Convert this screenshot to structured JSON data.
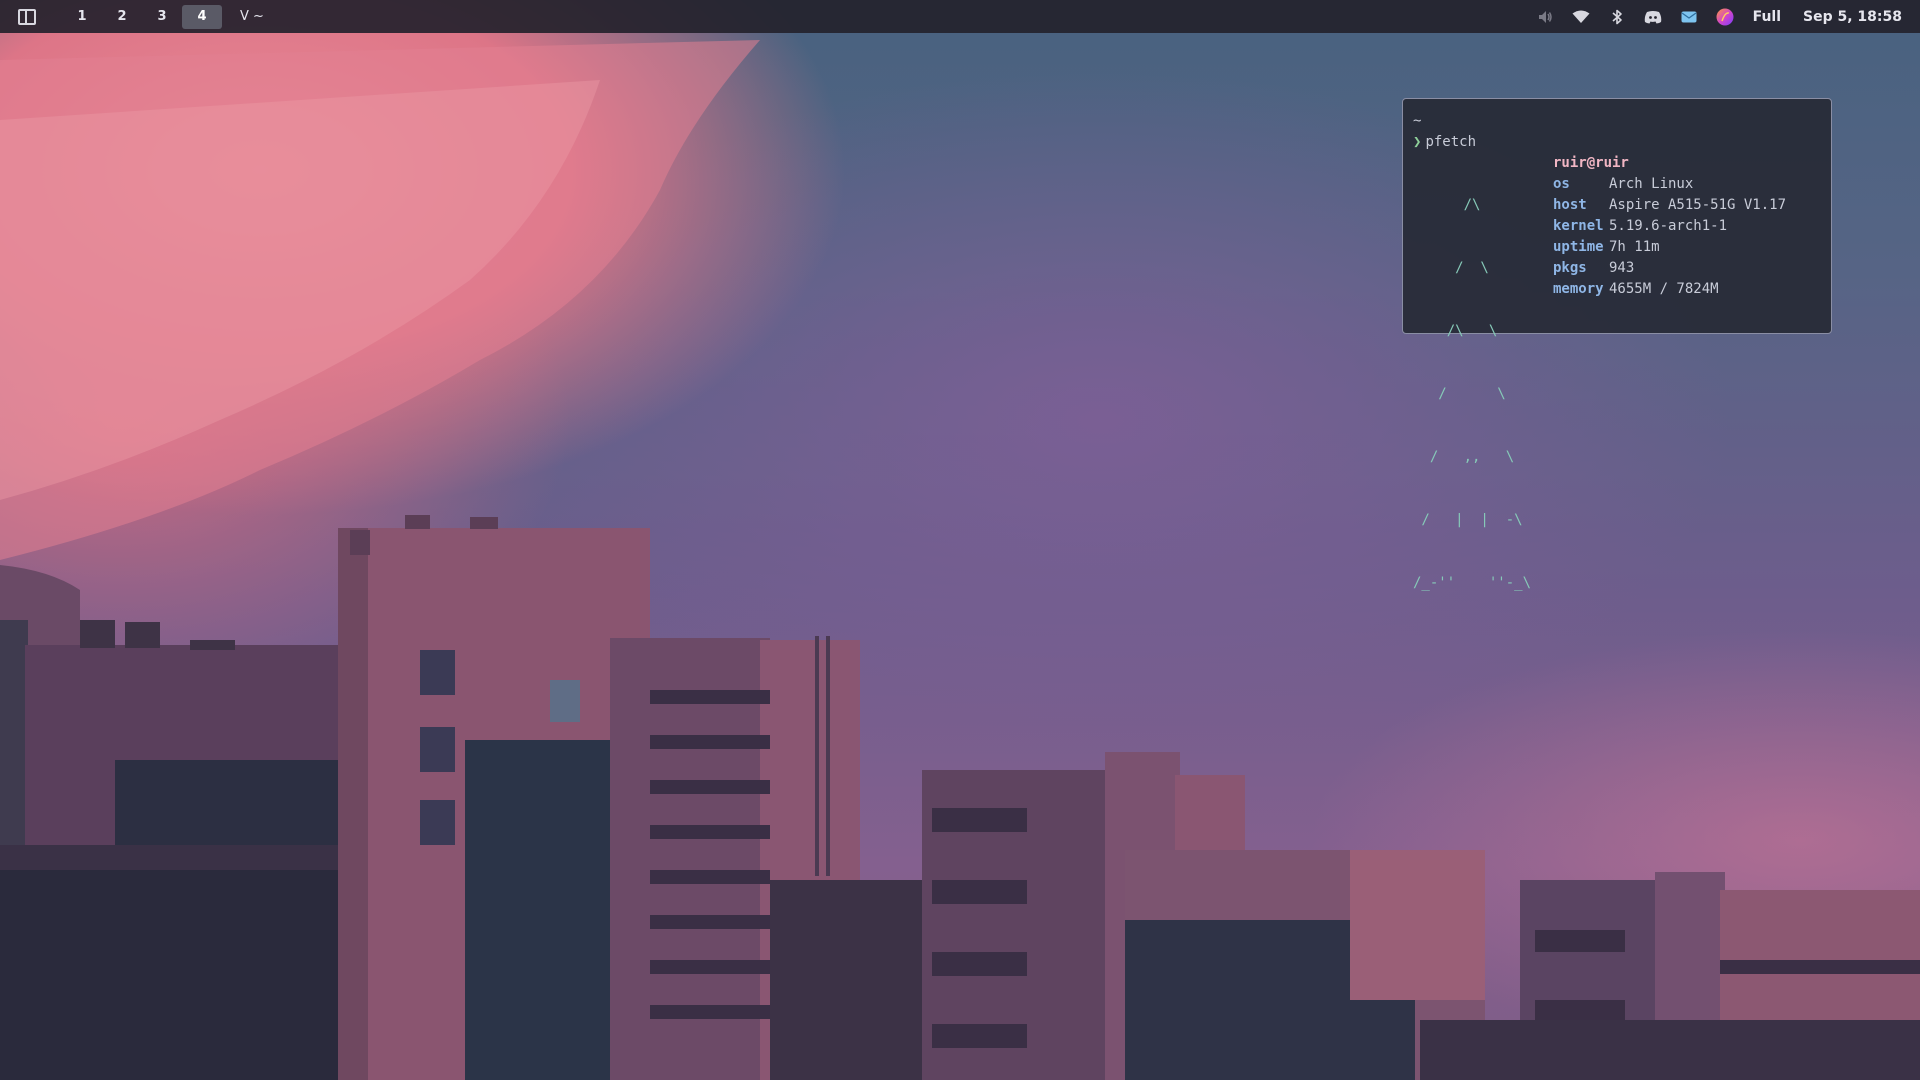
{
  "topbar": {
    "workspaces": [
      "1",
      "2",
      "3",
      "4"
    ],
    "active_workspace": "4",
    "window_title": "V ~",
    "tray": [
      "volume-icon",
      "wifi-icon",
      "bluetooth-icon",
      "discord-icon",
      "mail-icon",
      "app-orb-icon"
    ],
    "battery": "Full",
    "clock": "Sep 5, 18:58"
  },
  "terminal": {
    "cwd": "~",
    "prompt_symbol": "❯",
    "command": "pfetch",
    "userhost": "ruir@ruir",
    "ascii_art": [
      "      /\\",
      "     /  \\",
      "    /\\   \\",
      "   /      \\",
      "  /   ,,   \\",
      " /   |  |  -\\",
      "/_-''    ''-_\\"
    ],
    "info": [
      {
        "key": "os",
        "value": "Arch Linux"
      },
      {
        "key": "host",
        "value": "Aspire A515-51G V1.17"
      },
      {
        "key": "kernel",
        "value": "5.19.6-arch1-1"
      },
      {
        "key": "uptime",
        "value": "7h 11m"
      },
      {
        "key": "pkgs",
        "value": "943"
      },
      {
        "key": "memory",
        "value": "4655M / 7824M"
      }
    ]
  },
  "colors": {
    "bar_bg": "#24222c",
    "terminal_bg": "#272a36",
    "ascii": "#86c9b8",
    "info_key": "#8fb6e6",
    "userhost": "#f1b6c4"
  }
}
